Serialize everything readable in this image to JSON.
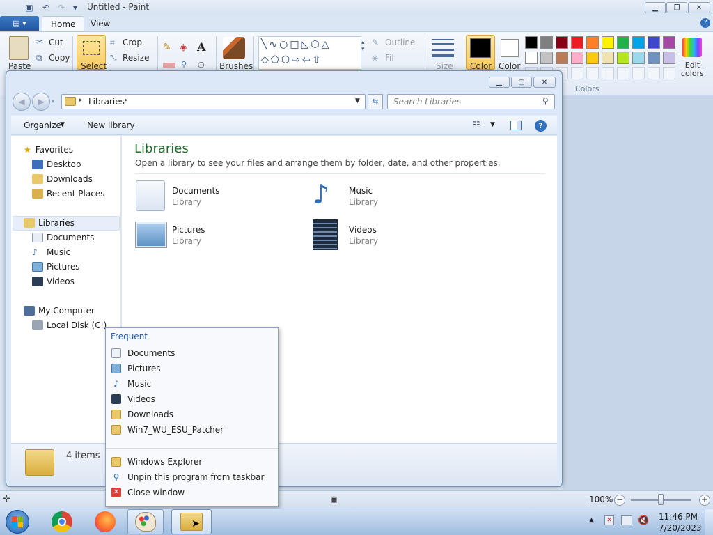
{
  "paint": {
    "title": "Untitled - Paint",
    "tabs": [
      "Home",
      "View"
    ],
    "clipboard": {
      "paste": "Paste",
      "cut": "Cut",
      "copy": "Copy"
    },
    "image": {
      "select": "Select",
      "crop": "Crop",
      "resize": "Resize"
    },
    "brushes": "Brushes",
    "shapes": {
      "outline": "Outline",
      "fill": "Fill"
    },
    "size": "Size",
    "color1": "Color",
    "color2": "Color",
    "colors_group": "Colors",
    "edit_colors": "Edit\ncolors",
    "palette": [
      "#000000",
      "#7f7f7f",
      "#880015",
      "#ed1c24",
      "#ff7f27",
      "#fff200",
      "#22b14c",
      "#00a2e8",
      "#3f48cc",
      "#a349a4",
      "#ffffff",
      "#c3c3c3",
      "#b97a57",
      "#ffaec9",
      "#ffc90e",
      "#efe4b0",
      "#b5e61d",
      "#99d9ea",
      "#7092be",
      "#c8bfe7"
    ],
    "zoom": "100%"
  },
  "explorer": {
    "breadcrumb": "Libraries",
    "search_placeholder": "Search Libraries",
    "toolbar": {
      "organize": "Organize",
      "new_library": "New library"
    },
    "nav": {
      "favorites": "Favorites",
      "favorites_items": [
        "Desktop",
        "Downloads",
        "Recent Places"
      ],
      "libraries": "Libraries",
      "libraries_items": [
        "Documents",
        "Music",
        "Pictures",
        "Videos"
      ],
      "computer": "My Computer",
      "computer_items": [
        "Local Disk (C:)"
      ]
    },
    "heading": "Libraries",
    "subheading": "Open a library to see your files and arrange them by folder, date, and other properties.",
    "libraries": [
      {
        "name": "Documents",
        "type": "Library"
      },
      {
        "name": "Music",
        "type": "Library"
      },
      {
        "name": "Pictures",
        "type": "Library"
      },
      {
        "name": "Videos",
        "type": "Library"
      }
    ],
    "items_count": "4 items"
  },
  "jumplist": {
    "section": "Frequent",
    "frequent": [
      "Documents",
      "Pictures",
      "Music",
      "Videos",
      "Downloads",
      "Win7_WU_ESU_Patcher"
    ],
    "tasks": [
      "Windows Explorer",
      "Unpin this program from taskbar",
      "Close window"
    ]
  },
  "taskbar": {
    "time": "11:46 PM",
    "date": "7/20/2023"
  }
}
